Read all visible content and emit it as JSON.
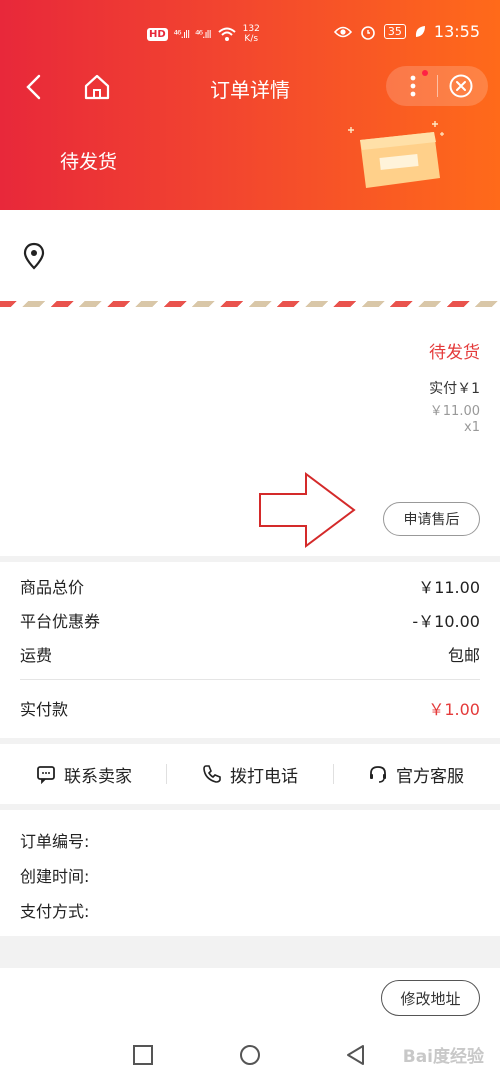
{
  "status_bar": {
    "hd": "HD",
    "network_1": "⁴⁶.ıll",
    "network_2": "⁴⁶.ıll",
    "speed_value": "132",
    "speed_unit": "K/s",
    "battery": "35",
    "time": "13:55"
  },
  "nav": {
    "title": "订单详情"
  },
  "order": {
    "status_banner": "待发货"
  },
  "goods": {
    "status": "待发货",
    "paid": "实付￥1",
    "price": "￥11.00",
    "quantity": "x1",
    "after_sale_label": "申请售后"
  },
  "fees": {
    "rows": [
      {
        "label": "商品总价",
        "value": "￥11.00"
      },
      {
        "label": "平台优惠券",
        "value": "-￥10.00"
      },
      {
        "label": "运费",
        "value": "包邮"
      }
    ],
    "total_label": "实付款",
    "total_value": "￥1.00"
  },
  "contact": {
    "seller": "联系卖家",
    "phone": "拨打电话",
    "service": "官方客服"
  },
  "info": {
    "order_number_label": "订单编号:",
    "created_label": "创建时间:",
    "payment_label": "支付方式:"
  },
  "bottom": {
    "modify_address_label": "修改地址"
  },
  "watermark": "Bai度经验",
  "colors": {
    "header_start": "#e8283a",
    "header_end": "#ff6a1a",
    "accent_red": "#e43a3a"
  }
}
